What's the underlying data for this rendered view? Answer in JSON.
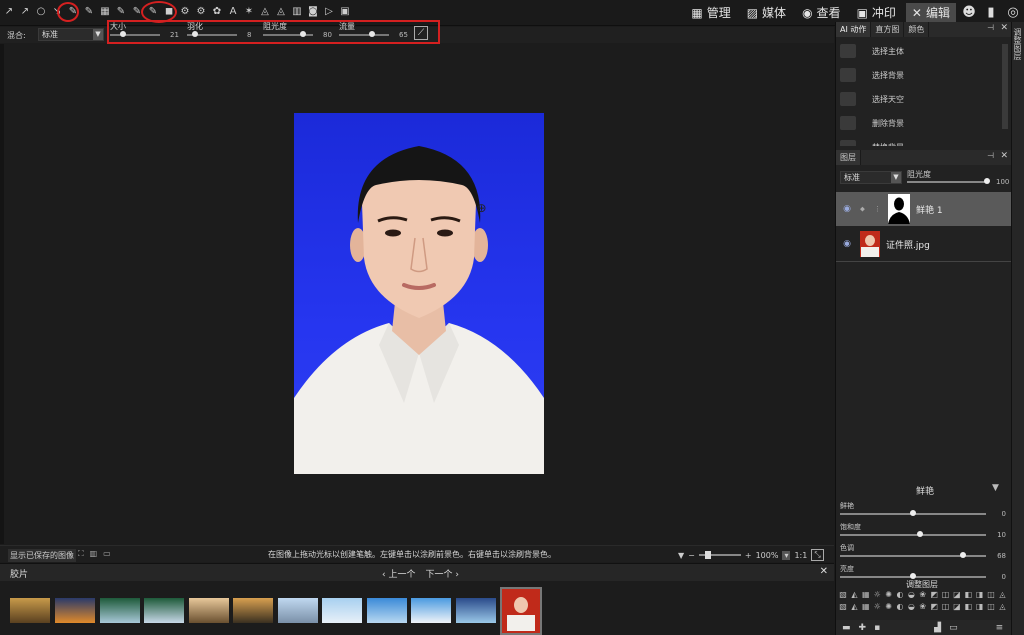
{
  "toolbar": {
    "tools": [
      "↗",
      "↗",
      "○",
      "↘",
      "✎",
      "✎",
      "▦",
      "✎",
      "✎",
      "✎",
      "◼",
      "⚙",
      "⚙",
      "✿",
      "A",
      "✶",
      "◬",
      "◬",
      "▥",
      "◙",
      "▷",
      "▣"
    ],
    "modes": [
      {
        "icon": "▦",
        "label": "管理"
      },
      {
        "icon": "▨",
        "label": "媒体"
      },
      {
        "icon": "◉",
        "label": "查看"
      },
      {
        "icon": "▣",
        "label": "冲印"
      },
      {
        "icon": "✕",
        "label": "编辑"
      }
    ]
  },
  "options": {
    "blend_label": "混合:",
    "blend_value": "标准",
    "sliders": [
      {
        "label": "大小",
        "value": "21",
        "pos": 0.25
      },
      {
        "label": "羽化",
        "value": "8",
        "pos": 0.15
      },
      {
        "label": "阻光度",
        "value": "80",
        "pos": 0.8
      },
      {
        "label": "流量",
        "value": "65",
        "pos": 0.65
      }
    ]
  },
  "status": {
    "saved_button": "显示已保存的图像",
    "hint": "在图像上拖动光标以创建笔触。左键单击以涂刷前景色。右键单击以涂刷背景色。",
    "zoom": "100%",
    "ratio": "1:1"
  },
  "filmstrip": {
    "tab": "胶片",
    "prev": "上一个",
    "next": "下一个",
    "thumbs": [
      {
        "c1": "#c89a4a",
        "c2": "#5a4020"
      },
      {
        "c1": "#2a3a6a",
        "c2": "#e08a2a"
      },
      {
        "c1": "#1e5a3a",
        "c2": "#a8c8d8"
      },
      {
        "c1": "#1e5a3a",
        "c2": "#c8d8e8"
      },
      {
        "c1": "#e8c89a",
        "c2": "#6a5030"
      },
      {
        "c1": "#d8a050",
        "c2": "#3a3020"
      },
      {
        "c1": "#c0d8f0",
        "c2": "#7a90a8"
      },
      {
        "c1": "#a8d0f0",
        "c2": "#e8f0f8"
      },
      {
        "c1": "#3a8ad8",
        "c2": "#b8d8f0"
      },
      {
        "c1": "#4a9ae0",
        "c2": "#f0f4f8"
      },
      {
        "c1": "#2a4a8a",
        "c2": "#9ac8e8"
      },
      {
        "c1": "#c02a1a",
        "c2": "#f0f0f0"
      }
    ]
  },
  "right_panel": {
    "tabs": [
      "AI 动作",
      "直方图",
      "颜色"
    ],
    "ai_actions": [
      "选择主体",
      "选择背景",
      "选择天空",
      "删除背景",
      "替换背景"
    ],
    "vertical_tab": "调整图层",
    "layers_tab": "图层",
    "layer_blend": "标准",
    "opacity_label": "阻光度",
    "opacity_value": "100",
    "layers": [
      {
        "name": "鲜艳 1",
        "selected": true
      },
      {
        "name": "证件照.jpg",
        "selected": false
      }
    ],
    "adjust_title": "鲜艳",
    "adjustments": [
      {
        "label": "鲜艳",
        "value": "0",
        "pos": 0.5
      },
      {
        "label": "饱和度",
        "value": "10",
        "pos": 0.55
      },
      {
        "label": "色调",
        "value": "68",
        "pos": 0.84
      },
      {
        "label": "亮度",
        "value": "0",
        "pos": 0.5
      }
    ],
    "adjust_layers_title": "调整图层"
  }
}
